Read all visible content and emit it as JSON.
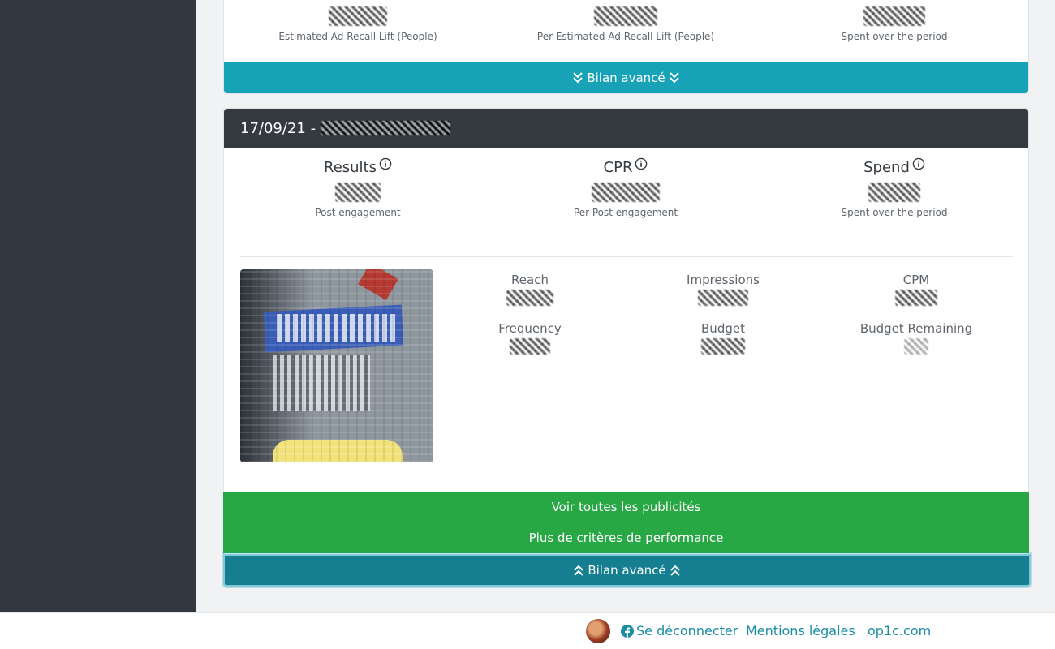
{
  "top_card": {
    "metrics": [
      {
        "sublabel": "Estimated Ad Recall Lift (People)"
      },
      {
        "sublabel": "Per Estimated Ad Recall Lift (People)"
      },
      {
        "sublabel": "Spent over the period"
      }
    ],
    "bilan_label": "Bilan avancé"
  },
  "card": {
    "header_date": "17/09/21 -",
    "kpis": [
      {
        "title": "Results",
        "sublabel": "Post engagement",
        "icon": "info-icon"
      },
      {
        "title": "CPR",
        "sublabel": "Per Post engagement",
        "icon": "info-icon"
      },
      {
        "title": "Spend",
        "sublabel": "Spent over the period",
        "icon": "info-icon"
      }
    ],
    "stats": [
      {
        "label": "Reach"
      },
      {
        "label": "Impressions"
      },
      {
        "label": "CPM"
      },
      {
        "label": "Frequency"
      },
      {
        "label": "Budget"
      },
      {
        "label": "Budget Remaining"
      }
    ],
    "see_all_ads_label": "Voir toutes les publicités",
    "more_criteria_label": "Plus de critères de performance",
    "bilan_label": "Bilan avancé"
  },
  "footer": {
    "logout_label": "Se déconnecter",
    "legal_label": "Mentions légales",
    "site_label": "op1c.com"
  },
  "colors": {
    "sidebar": "#323740",
    "header": "#343a40",
    "info_blue": "#17a2b8",
    "success_green": "#28a745",
    "link": "#1a8ca5"
  }
}
